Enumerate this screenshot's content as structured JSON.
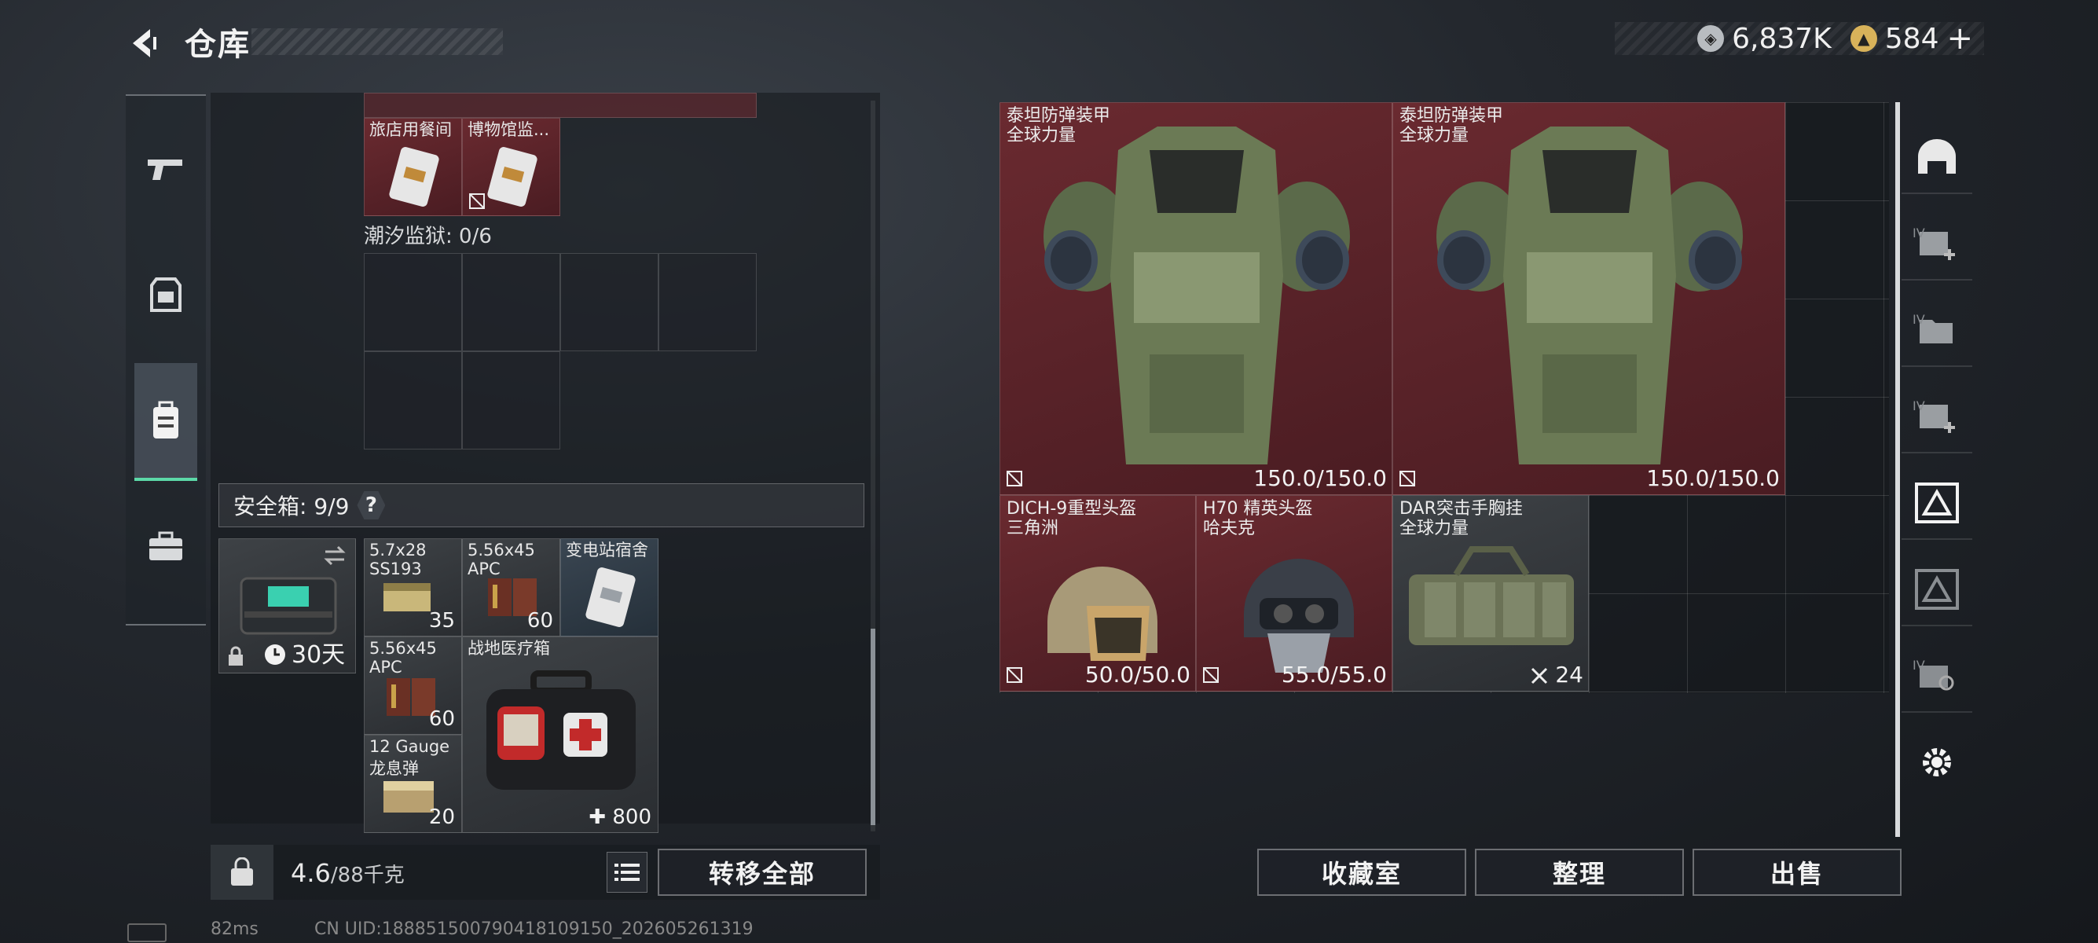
{
  "header": {
    "title": "仓库"
  },
  "currency": {
    "silver": "6,837K",
    "gold": "584",
    "gold_plus": "+"
  },
  "left_tabs": [
    {
      "name": "weapons-tab",
      "icon": "pistol-icon"
    },
    {
      "name": "gear-tab",
      "icon": "vest-icon"
    },
    {
      "name": "backpack-tab",
      "icon": "backpack-icon",
      "active": true
    },
    {
      "name": "case-tab",
      "icon": "briefcase-icon"
    }
  ],
  "containers": {
    "top_items": [
      {
        "name": "旅店用餐间",
        "type": "keycard"
      },
      {
        "name": "博物馆监...",
        "type": "keycard",
        "marked": true
      }
    ],
    "prison_label": "潮汐监狱: 0/6"
  },
  "safe_box": {
    "label": "安全箱: 9/9",
    "help": "?",
    "duration": "30天",
    "items": [
      {
        "name_line1": "5.7x28",
        "name_line2": "SS193",
        "count": "35",
        "color": "dark"
      },
      {
        "name_line1": "5.56x45",
        "name_line2": "APC",
        "count": "60",
        "color": "dark"
      },
      {
        "name_line1": "变电站宿舍",
        "name_line2": "",
        "count": "",
        "color": "blue"
      },
      {
        "name_line1": "5.56x45",
        "name_line2": "APC",
        "count": "60",
        "color": "dark"
      },
      {
        "name_line1": "战地医疗箱",
        "name_line2": "",
        "count": "800",
        "color": "dark"
      },
      {
        "name_line1": "12 Gauge",
        "name_line2": "龙息弹",
        "count": "20",
        "color": "dark"
      }
    ]
  },
  "weight": {
    "current": "4.6",
    "max": "/88千克"
  },
  "buttons": {
    "transfer_all": "转移全部",
    "collection": "收藏室",
    "organize": "整理",
    "sell": "出售"
  },
  "stash_items": [
    {
      "name": "泰坦防弹装甲",
      "sub": "全球力量",
      "value": "150.0/150.0",
      "kind": "armor"
    },
    {
      "name": "泰坦防弹装甲",
      "sub": "全球力量",
      "value": "150.0/150.0",
      "kind": "armor"
    },
    {
      "name": "DICH-9重型头盔",
      "sub": "三角洲",
      "value": "50.0/50.0",
      "kind": "helmet-desert"
    },
    {
      "name": "H70 精英头盔",
      "sub": "哈夫克",
      "value": "55.0/55.0",
      "kind": "helmet-dark"
    },
    {
      "name": "DAR突击手胸挂",
      "sub": "全球力量",
      "value": "24",
      "kind": "chest-rig"
    }
  ],
  "right_rail": [
    {
      "name": "helmet-filter-tab",
      "label": ""
    },
    {
      "name": "armor-plus-tab",
      "label": "IV"
    },
    {
      "name": "folder-tab",
      "label": "IV"
    },
    {
      "name": "armor-plus-tab-2",
      "label": "IV"
    },
    {
      "name": "triangle-filter-tab",
      "label": "",
      "active": true
    },
    {
      "name": "triangle-filter-tab-2",
      "label": ""
    },
    {
      "name": "search-tab",
      "label": "IV"
    }
  ],
  "footer": {
    "ping": "82ms",
    "uid": "CN UID:188851500790418109150_202605261319"
  },
  "colors": {
    "accent": "#5cd9a8",
    "item_red": "#6a2a30",
    "item_dark": "#3e4246"
  }
}
